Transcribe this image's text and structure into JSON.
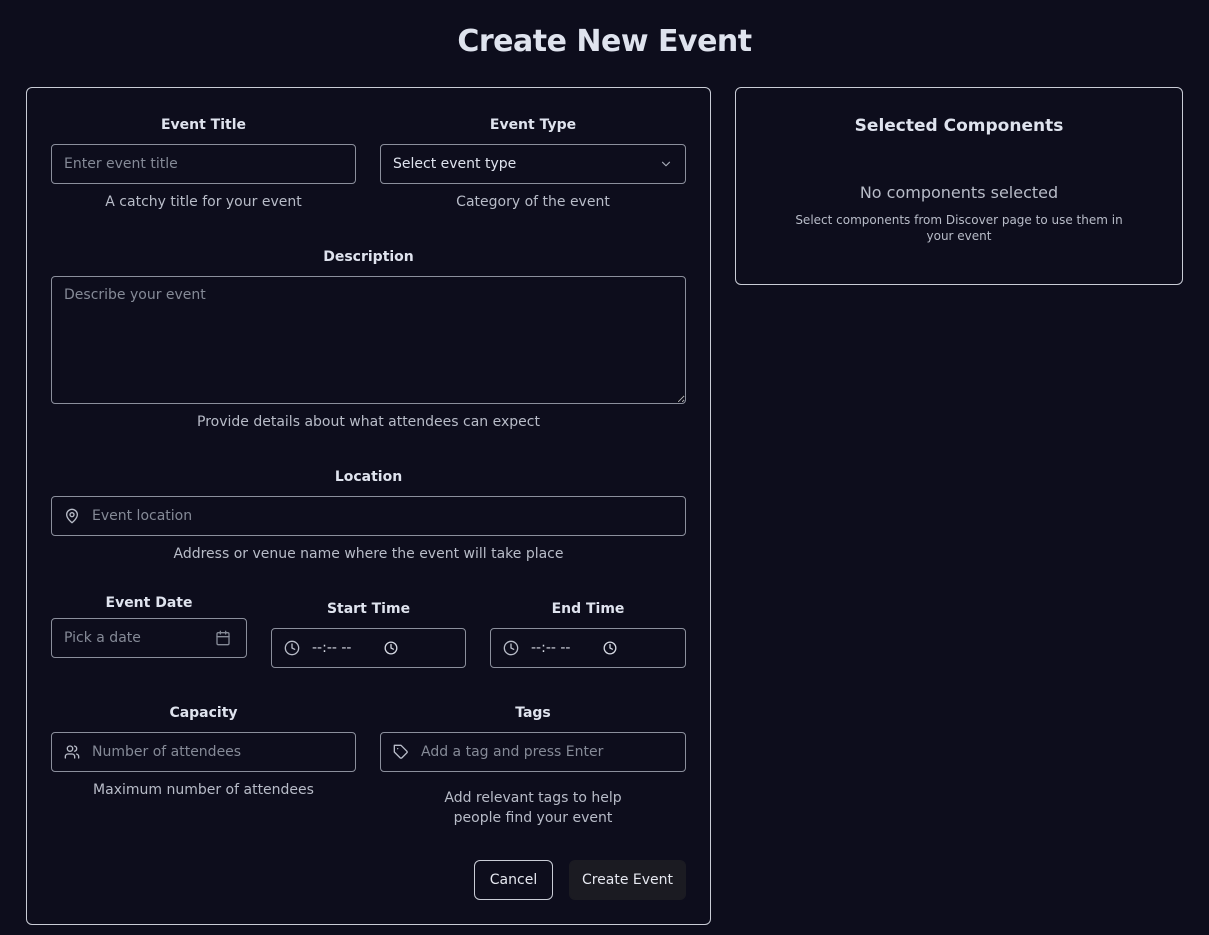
{
  "page": {
    "title": "Create New Event"
  },
  "form": {
    "event_title": {
      "label": "Event Title",
      "placeholder": "Enter event title",
      "hint": "A catchy title for your event",
      "value": ""
    },
    "event_type": {
      "label": "Event Type",
      "selected": "Select event type",
      "hint": "Category of the event",
      "icon": "chevron-down-icon"
    },
    "description": {
      "label": "Description",
      "placeholder": "Describe your event",
      "hint": "Provide details about what attendees can expect",
      "value": ""
    },
    "location": {
      "label": "Location",
      "placeholder": "Event location",
      "hint": "Address or venue name where the event will take place",
      "icon": "map-pin-icon"
    },
    "event_date": {
      "label": "Event Date",
      "placeholder": "Pick a date",
      "icon": "calendar-icon"
    },
    "start_time": {
      "label": "Start Time",
      "value": "--:-- --",
      "icon": "clock-icon"
    },
    "end_time": {
      "label": "End Time",
      "value": "--:-- --",
      "icon": "clock-icon"
    },
    "capacity": {
      "label": "Capacity",
      "placeholder": "Number of attendees",
      "hint": "Maximum number of attendees",
      "icon": "users-icon"
    },
    "tags": {
      "label": "Tags",
      "placeholder": "Add a tag and press Enter",
      "hint": "Add relevant tags to help people find your event",
      "icon": "tag-icon"
    },
    "actions": {
      "cancel_label": "Cancel",
      "create_label": "Create Event"
    }
  },
  "selected_components": {
    "title": "Selected Components",
    "empty_title": "No components selected",
    "empty_text": "Select components from Discover page to use them in your event"
  },
  "colors": {
    "background": "#0d0d1c",
    "border": "#c9ccd6",
    "input_border": "#8b8f9c",
    "primary_button": "#1b1b22"
  }
}
